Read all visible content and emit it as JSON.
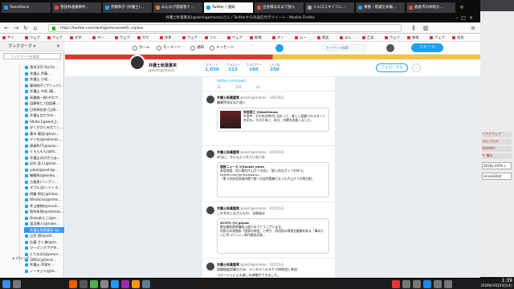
{
  "browser": {
    "tabs": [
      {
        "label": "TweetDeck",
        "color": "#1da1f2"
      },
      {
        "label": "冒談林通議事件...",
        "color": "#e74c3c"
      },
      {
        "label": "伊藤和子 (弁護士)...",
        "color": "#1da1f2"
      },
      {
        "label": "みんなが容疑者ナ...",
        "color": "#e67e22"
      },
      {
        "label": "Twitter / 通知",
        "color": "#1da1f2"
      },
      {
        "label": "出会場はあまで狭入",
        "color": "#e74c3c"
      },
      {
        "label": "ジェロスキゾフレ...",
        "color": "#95a5a6"
      },
      {
        "label": "事態・意識を体験...",
        "color": "#3498db"
      },
      {
        "label": "板倉市の体制大...",
        "color": "#e74c3c"
      }
    ],
    "active_tab_label": "弁護士秋葉重実(@akshigemaroo)さん / Twitterからの返信付きツイート - Mozilla Firefox",
    "window_title": "弁護士秋葉重実(@akshigemaroo)さん / Twitterからの返信付きツイート - Mozilla Firefox",
    "url": "https://twitter.com/akshigemaroo/with_replies",
    "bookmarks": [
      "サイ",
      "ウェブ",
      "ウェブ",
      "文学",
      "ホー",
      "ウェブ",
      "ガス",
      "作家",
      "ウェブ",
      "ツイ",
      "ウェブ",
      "新規",
      "テン",
      "ムー",
      "奥女",
      "まん",
      "乙女",
      "ウェブ",
      "無視",
      "ウェブ",
      "詰合"
    ]
  },
  "sidebar": {
    "title": "ブックマーク ▾",
    "search_placeholder": "ブックマークを検索",
    "items": [
      "落合洋司 Yoj-Oc...",
      "弁護士 伊藤...",
      "弁護士 小松...",
      "藤岡純子 (プリック)...",
      "弁護士 中松 (藤...",
      "高橋雄一郎(デロブ...",
      "田藤裕仁 (旧田藤...",
      "日体林宏彦 (日体...",
      "弁護士比たちの...",
      "Shoko Egawa(江...",
      "ぼくがひとみ比てく...",
      "藤永 藤田(@kiyo...",
      "ヤイ丸(@sakanas...",
      "偉員KUT(@ayou...",
      "ぐえんもん(@ta...",
      "弁護士ぼび大ら@...",
      "沢村 亜人(@kilai...",
      "yoko(@aoshi@...",
      "機動隊(@kenbo...",
      "古賀恵(ベンブソ...",
      "ダブル法(ヘイトス...",
      "明輪 飛丸(@hikas...",
      "WhoScha(@mhsi...",
      "井上綾物(@inouk...",
      "和利有物(@rahmas...",
      "Dukeあえこ(@ie...",
      "渡辺輝人(@nabe...",
      "弁護士秋葉重実 (@...",
      "山笠 現(@sotl...",
      "広義 さく森(@sa...",
      "ワーキングプア弁...",
      "とりなお(@yasun...",
      "SWGs(@Sensi..."
    ],
    "selected_index": 27,
    "group_label": "グループ",
    "group_items": [
      "弁護士 声援を...",
      "ノーラジャ(@m..."
    ]
  },
  "twitter": {
    "nav": [
      "ホーム",
      "モーメント",
      "通知",
      "メッセージ"
    ],
    "search_placeholder": "キーワード検索",
    "tweet_button": "ツイート",
    "profile_name": "弁護士秋葉重実",
    "profile_handle": "@akshigemaroo",
    "stats": [
      {
        "label": "ツイート",
        "value": "1,038"
      },
      {
        "label": "フォロー",
        "value": "213"
      },
      {
        "label": "フォロワー",
        "value": "160"
      },
      {
        "label": "いいね",
        "value": "250"
      }
    ],
    "follow_button": "フォローする",
    "more_button": "⋯",
    "top_text": "twitter.com/i/web/...",
    "top_actions": [
      "11",
      "115",
      "11"
    ],
    "tweets": [
      {
        "name": "弁護士秋葉重実",
        "meta": "@akshigemaroo · 10月19日",
        "text": "職業特化はまだ遠く",
        "quote_name": "安倍晋三 @AbeShinzo",
        "quote_text": "午前中、その先の時代に向かって、新しい国創りのスタートを切る。そのために、本日、内閣を改造しました。"
      },
      {
        "name": "弁護士秋葉重実",
        "meta": "@akshigemaroo · 10月19日",
        "text": "本当に。ちゃんと入れていない方",
        "quote_name": "産経ニュース @Sankei_news",
        "quote_text": "安倍首相、初入閣の片山さつき氏に「超入的なガッツを持つ」twitter.com/jjmiss/status/...",
        "quote_extra": "「第４次安倍改造内閣で唯一の女性閣僚となった片山さつき地方創..."
      },
      {
        "name": "弁護士秋葉重実",
        "meta": "@akshigemaroo · 10月15日",
        "text": "これをめしおさんもの、法務省は",
        "quote_name": "GCSTC @t_gesub",
        "quote_text": "療法薬処理装備処入理ためでとうございます。",
        "quote_extra": "利用元年発掘条「国家の持定」と呼び、利用長の再宿泊優勝を取る「事みたいに作っていい」新付検出対談..."
      },
      {
        "name": "弁護士秋葉重実",
        "meta": "@akshigemaroo · 10月15日",
        "text": "知識検査試験のため、メンタルヘルスケア研修会に参加",
        "extra": "コラージュによる楽しみ体験ができました。"
      }
    ]
  },
  "background_window": {
    "lines": [
      "ソフトウェア",
      "ぶん いいん",
      "SQAMLP",
      "ア 場は"
    ],
    "fields": [
      "2018y-2019 s",
      "screenShot"
    ]
  },
  "taskbar": {
    "time": "1:39",
    "date": "2018年10月03日(木)"
  },
  "colors": {
    "accent": "#1da1f2",
    "firefox_dark": "#0c0c0d",
    "selection": "#3399ff"
  }
}
